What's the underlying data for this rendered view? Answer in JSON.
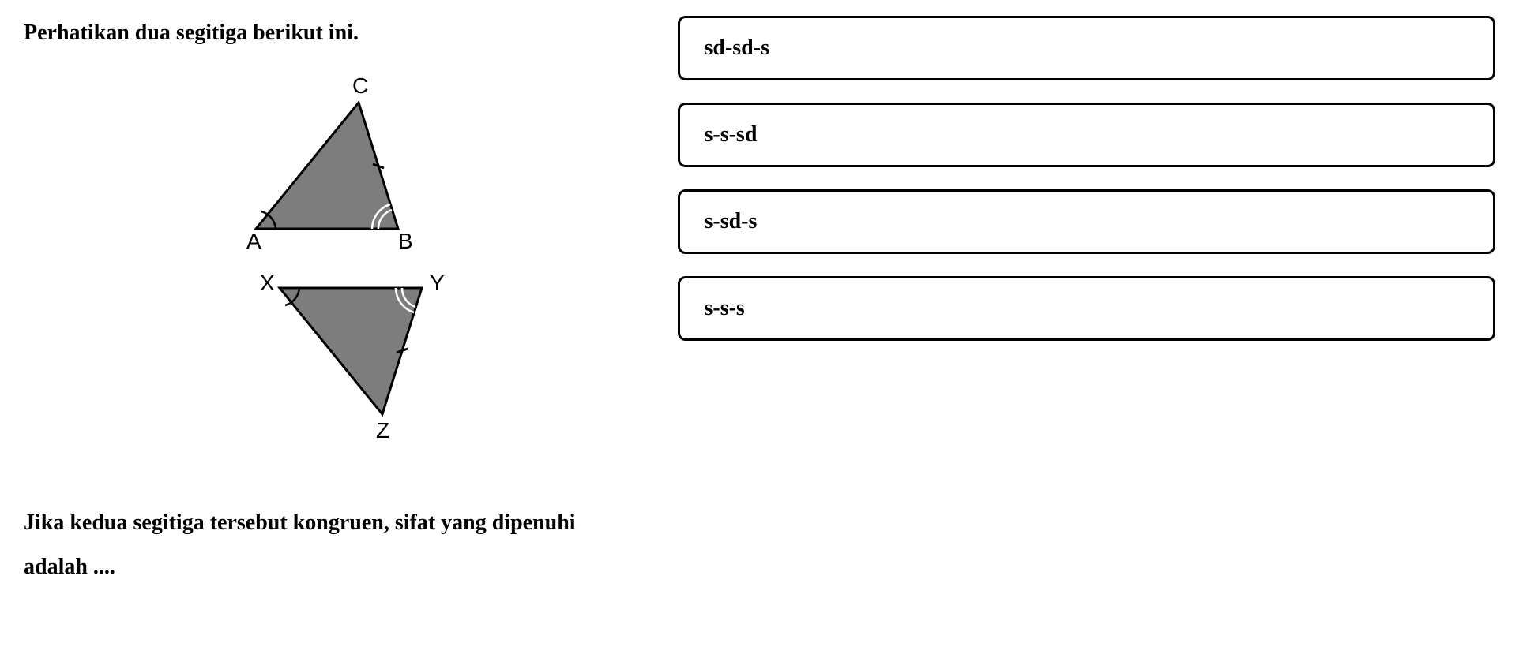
{
  "question": {
    "intro": "Perhatikan dua segitiga berikut ini.",
    "prompt_line1": "Jika kedua segitiga tersebut kongruen, sifat yang dipenuhi",
    "prompt_line2": "adalah ...."
  },
  "figure": {
    "triangle1": {
      "labels": {
        "A": "A",
        "B": "B",
        "C": "C"
      }
    },
    "triangle2": {
      "labels": {
        "X": "X",
        "Y": "Y",
        "Z": "Z"
      }
    }
  },
  "options": {
    "a": "sd-sd-s",
    "b": "s-s-sd",
    "c": "s-sd-s",
    "d": "s-s-s"
  }
}
